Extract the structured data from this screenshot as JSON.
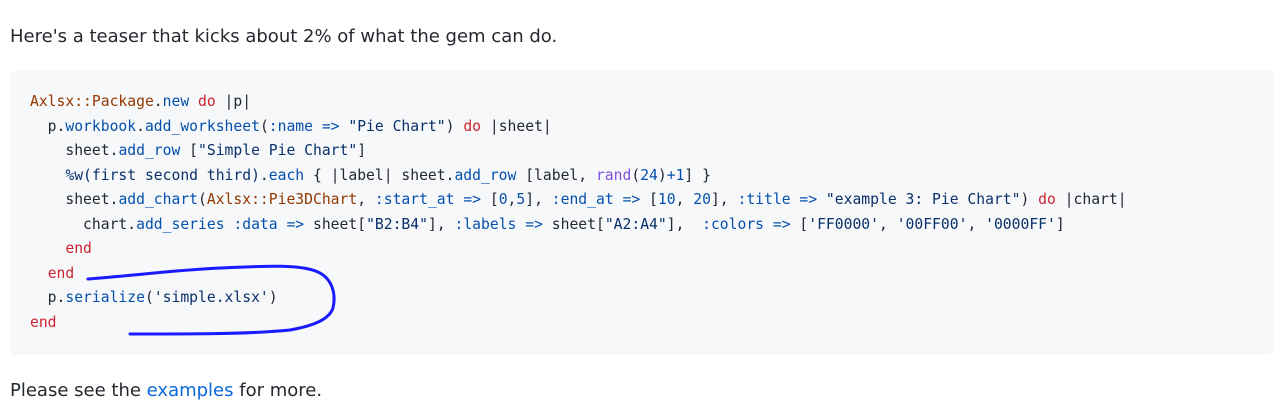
{
  "intro_text": "Here's a teaser that kicks about 2% of what the gem can do.",
  "code": {
    "l1": [
      "Axlsx::Package",
      ".",
      "new",
      " ",
      "do",
      " |p|"
    ],
    "l2": [
      "  p",
      ".",
      "workbook",
      ".",
      "add_worksheet",
      "(",
      ":name",
      " ",
      "=>",
      " ",
      "\"Pie Chart\"",
      ") ",
      "do",
      " |sheet|"
    ],
    "l3": [
      "    sheet",
      ".",
      "add_row",
      " [",
      "\"Simple Pie Chart\"",
      "]"
    ],
    "l4": [
      "    ",
      "%w(first second third)",
      ".",
      "each",
      " { |label| sheet",
      ".",
      "add_row",
      " [label, ",
      "rand",
      "(",
      "24",
      ")",
      "+",
      "1",
      "] }"
    ],
    "l5": [
      "    sheet",
      ".",
      "add_chart",
      "(",
      "Axlsx::Pie3DChart",
      ", ",
      ":start_at",
      " ",
      "=>",
      " [",
      "0",
      ",",
      "5",
      "], ",
      ":end_at",
      " ",
      "=>",
      " [",
      "10",
      ", ",
      "20",
      "], ",
      ":title",
      " ",
      "=>",
      " ",
      "\"example 3: Pie Chart\"",
      ") ",
      "do",
      " |chart|"
    ],
    "l6": [
      "      chart",
      ".",
      "add_series",
      " ",
      ":data",
      " ",
      "=>",
      " sheet[",
      "\"B2:B4\"",
      "], ",
      ":labels",
      " ",
      "=>",
      " sheet[",
      "\"A2:A4\"",
      "],  ",
      ":colors",
      " ",
      "=>",
      " [",
      "'FF0000'",
      ", ",
      "'00FF00'",
      ", ",
      "'0000FF'",
      "]"
    ],
    "l7": [
      "    ",
      "end"
    ],
    "l8": [
      "  ",
      "end"
    ],
    "l9": [
      "  p",
      ".",
      "serialize",
      "(",
      "'simple.xlsx'",
      ")"
    ],
    "l10": [
      "end"
    ]
  },
  "outro": {
    "before": "Please see the ",
    "link": "examples",
    "after": " for more."
  },
  "colors": {
    "annotation_stroke": "#1a1aff"
  }
}
